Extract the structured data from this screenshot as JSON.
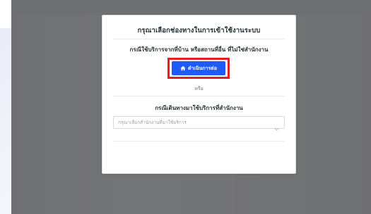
{
  "modal": {
    "title": "กรุณาเลือกช่องทางในการเข้าใช้งานระบบ",
    "home_caption": "กรณีใช้บริการจากที่บ้าน หรือสถานที่อื่น ที่ไม่ใช่สำนักงาน",
    "proceed_button_label": "ดำเนินการต่อ",
    "proceed_button_icon": "home-icon",
    "or_label": "หรือ",
    "office_caption": "กรณีเดินทางมาใช้บริการที่สำนักงาน",
    "office_select": {
      "selected_value": "กรุณาเลือกสำนักงานที่มาใช้บริการ",
      "options": []
    }
  },
  "colors": {
    "overlay": "#737476",
    "button": "#1f5bf6",
    "highlight": "#e21f24"
  }
}
